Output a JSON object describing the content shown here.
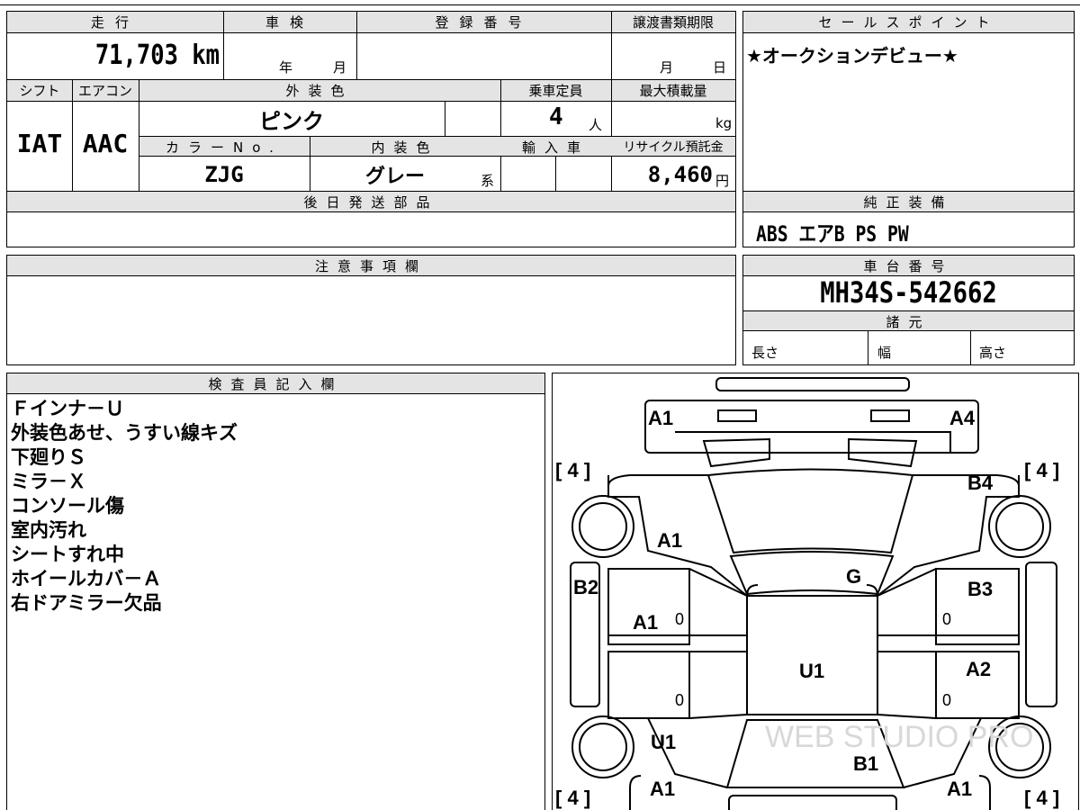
{
  "top_info": {
    "headers": {
      "mileage": "走行",
      "inspection": "車検",
      "registration": "登録番号",
      "transfer_deadline": "譲渡書類期限",
      "sales_point": "セールスポイント",
      "shift": "シフト",
      "aircon": "エアコン",
      "exterior_color": "外装色",
      "capacity": "乗車定員",
      "max_load": "最大積載量",
      "color_no": "カラーNo.",
      "interior_color": "内装色",
      "imported": "輸入車",
      "recycle_deposit": "リサイクル預託金",
      "later_parts": "後日発送部品",
      "genuine_equipment": "純正装備",
      "notes": "注意事項欄",
      "chassis_no": "車台番号",
      "specs": "諸元",
      "inspector": "検査員記入欄"
    },
    "mileage_value": "71,703 km",
    "inspection_year_unit": "年",
    "inspection_month_unit": "月",
    "deadline_month_unit": "月",
    "deadline_day_unit": "日",
    "shift_value": "IAT",
    "aircon_value": "AAC",
    "exterior_color_value": "ピンク",
    "capacity_value": "4",
    "capacity_unit": "人",
    "max_load_unit": "kg",
    "color_no_value": "ZJG",
    "interior_color_value": "グレー",
    "interior_color_suffix": "系",
    "recycle_value": "8,460",
    "recycle_unit": "円",
    "sales_point_value": "★オークションデビュー★",
    "genuine_equipment_value": "ABS エアB PS PW",
    "chassis_no_value": "MH34S-542662",
    "spec_length": "長さ",
    "spec_width": "幅",
    "spec_height": "高さ"
  },
  "inspector_notes": [
    "Ｆインナ－Ｕ",
    "外装色あせ、うすい線キズ",
    "下廻りＳ",
    "ミラ－Ｘ",
    "コンソール傷",
    "室内汚れ",
    "シートすれ中",
    "ホイールカバ－Ａ",
    "右ドアミラー欠品"
  ],
  "diagram": {
    "labels": [
      "A1",
      "A4",
      "B4",
      "A1",
      "G",
      "B2",
      "B3",
      "A1",
      "U1",
      "A2",
      "U1",
      "B1",
      "A1",
      "A1"
    ],
    "zeros": [
      "0",
      "0",
      "0",
      "0"
    ],
    "tire_depth": [
      "4",
      "4",
      "4",
      "4"
    ],
    "watermark": "WEB STUDIO PRO"
  }
}
